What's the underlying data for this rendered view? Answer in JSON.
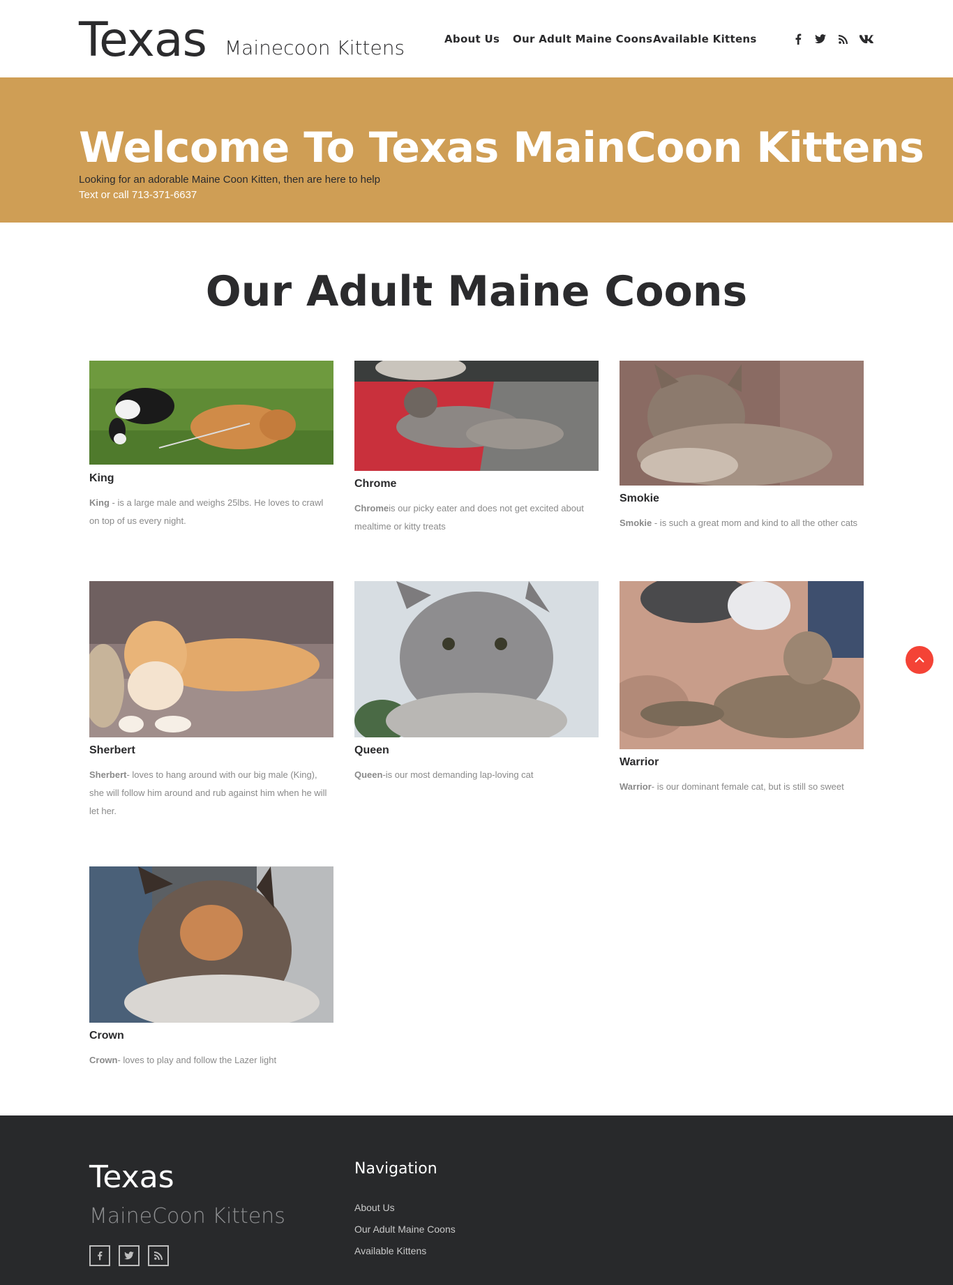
{
  "header": {
    "logo_main": "Texas",
    "logo_sub": "Mainecoon Kittens",
    "nav": [
      {
        "label": "About Us"
      },
      {
        "label": "Our Adult Maine Coons"
      },
      {
        "label": "Available Kittens"
      }
    ],
    "socials": [
      "facebook-icon",
      "twitter-icon",
      "rss-icon",
      "vk-icon"
    ]
  },
  "hero": {
    "title": "Welcome To Texas MainCoon Kittens",
    "line1": "Looking for an adorable Maine Coon Kitten, then are here to help",
    "line2": "Text or call 713-371-6637",
    "background_color": "#cf9e55"
  },
  "section": {
    "title": "Our Adult Maine Coons"
  },
  "cats": [
    {
      "name": "King",
      "desc_bold": "King",
      "desc_rest": " - is a large male and weighs 25lbs. He loves to crawl on top of us every night."
    },
    {
      "name": "Chrome",
      "desc_bold": "Chrome",
      "desc_rest": "is our picky eater and does not get excited about mealtime or kitty treats"
    },
    {
      "name": "Smokie",
      "desc_bold": "Smokie",
      "desc_rest": " - is such a great mom and kind to all the other cats"
    },
    {
      "name": "Sherbert",
      "desc_bold": "Sherbert",
      "desc_rest": "- loves to hang around with our big male (King), she will follow him around and rub against him when he will let her."
    },
    {
      "name": "Queen",
      "desc_bold": "Queen",
      "desc_rest": "-is our most demanding lap-loving cat"
    },
    {
      "name": "Warrior",
      "desc_bold": "Warrior",
      "desc_rest": "- is our dominant female cat, but is still so sweet"
    },
    {
      "name": "Crown",
      "desc_bold": "Crown",
      "desc_rest": "- loves to play and follow the Lazer light"
    }
  ],
  "footer": {
    "logo_main": "Texas",
    "logo_sub": "MaineCoon Kittens",
    "socials": [
      "facebook-icon",
      "twitter-icon",
      "rss-icon"
    ],
    "nav_title": "Navigation",
    "nav": [
      {
        "label": "About Us"
      },
      {
        "label": "Our Adult Maine Coons"
      },
      {
        "label": "Available Kittens"
      }
    ],
    "background_color": "#28292b"
  },
  "scroll_top": {
    "icon": "chevron-up-icon",
    "color": "#f44336"
  }
}
